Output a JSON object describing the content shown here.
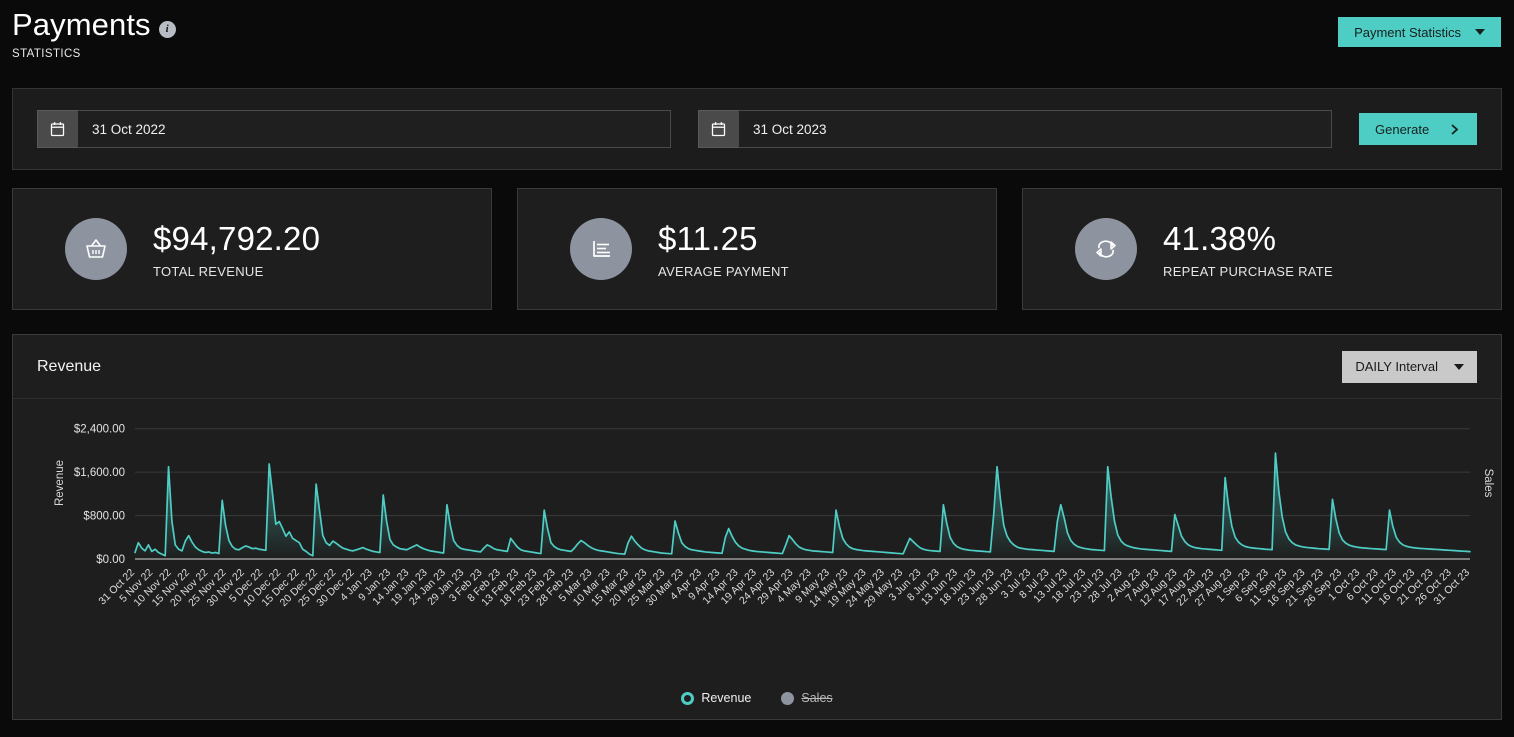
{
  "header": {
    "title": "Payments",
    "subtitle": "STATISTICS",
    "info_icon": "info-icon",
    "primary_button": {
      "label": "Payment Statistics",
      "icon": "chevron-down-icon",
      "color": "#4ecdc4"
    }
  },
  "filters": {
    "start_date": {
      "value": "31 Oct 2022",
      "placeholder": "31 Oct 2022",
      "icon": "calendar-icon"
    },
    "end_date": {
      "value": "31 Oct 2023",
      "placeholder": "31 Oct 2023",
      "icon": "calendar-icon"
    },
    "generate_button": {
      "label": "Generate",
      "icon": "chevron-right-icon",
      "color": "#4ecdc4"
    }
  },
  "stats": [
    {
      "value": "$94,792.20",
      "label": "TOTAL REVENUE",
      "icon": "shopping-basket-icon"
    },
    {
      "value": "$11.25",
      "label": "AVERAGE PAYMENT",
      "icon": "bar-chart-icon"
    },
    {
      "value": "41.38%",
      "label": "REPEAT PURCHASE RATE",
      "icon": "repeat-icon"
    }
  ],
  "chart_panel": {
    "title": "Revenue",
    "interval_button": {
      "label": "DAILY Interval",
      "icon": "chevron-down-icon"
    }
  },
  "chart_data": {
    "type": "line",
    "title": "Revenue",
    "xlabel": "",
    "ylabel": "Revenue",
    "y2label": "Sales",
    "ylim": [
      0,
      2800
    ],
    "yticks": [
      0,
      800,
      1600,
      2400
    ],
    "ytick_labels": [
      "$0.00",
      "$800.00",
      "$1,600.00",
      "$2,400.00"
    ],
    "grid": true,
    "legend_position": "bottom",
    "legend": [
      {
        "name": "Revenue",
        "color": "#4ecdc4",
        "enabled": true
      },
      {
        "name": "Sales",
        "color": "#8e93a0",
        "enabled": false
      }
    ],
    "xtick_labels": [
      "31 Oct 22",
      "5 Nov 22",
      "10 Nov 22",
      "15 Nov 22",
      "20 Nov 22",
      "25 Nov 22",
      "30 Nov 22",
      "5 Dec 22",
      "10 Dec 22",
      "15 Dec 22",
      "20 Dec 22",
      "25 Dec 22",
      "30 Dec 22",
      "4 Jan 23",
      "9 Jan 23",
      "14 Jan 23",
      "19 Jan 23",
      "24 Jan 23",
      "29 Jan 23",
      "3 Feb 23",
      "8 Feb 23",
      "13 Feb 23",
      "18 Feb 23",
      "23 Feb 23",
      "28 Feb 23",
      "5 Mar 23",
      "10 Mar 23",
      "15 Mar 23",
      "20 Mar 23",
      "25 Mar 23",
      "30 Mar 23",
      "4 Apr 23",
      "9 Apr 23",
      "14 Apr 23",
      "19 Apr 23",
      "24 Apr 23",
      "29 Apr 23",
      "4 May 23",
      "9 May 23",
      "14 May 23",
      "19 May 23",
      "24 May 23",
      "29 May 23",
      "3 Jun 23",
      "8 Jun 23",
      "13 Jun 23",
      "18 Jun 23",
      "23 Jun 23",
      "28 Jun 23",
      "3 Jul 23",
      "8 Jul 23",
      "13 Jul 23",
      "18 Jul 23",
      "23 Jul 23",
      "28 Jul 23",
      "2 Aug 23",
      "7 Aug 23",
      "12 Aug 23",
      "17 Aug 23",
      "22 Aug 23",
      "27 Aug 23",
      "1 Sep 23",
      "6 Sep 23",
      "11 Sep 23",
      "16 Sep 23",
      "21 Sep 23",
      "26 Sep 23",
      "1 Oct 23",
      "6 Oct 23",
      "11 Oct 23",
      "16 Oct 23",
      "21 Oct 23",
      "26 Oct 23",
      "31 Oct 23"
    ],
    "series": [
      {
        "name": "Revenue",
        "color": "#4ecdc4",
        "values": [
          120,
          300,
          200,
          150,
          260,
          140,
          180,
          120,
          90,
          60,
          1700,
          700,
          260,
          180,
          150,
          330,
          430,
          310,
          220,
          170,
          140,
          120,
          130,
          110,
          120,
          100,
          1080,
          620,
          340,
          230,
          180,
          170,
          210,
          240,
          220,
          190,
          200,
          180,
          170,
          160,
          1750,
          1200,
          640,
          690,
          560,
          420,
          500,
          380,
          340,
          300,
          180,
          140,
          90,
          60,
          1380,
          900,
          430,
          300,
          250,
          330,
          290,
          240,
          200,
          180,
          160,
          150,
          170,
          190,
          210,
          180,
          160,
          140,
          130,
          120,
          1180,
          700,
          360,
          260,
          220,
          190,
          180,
          170,
          200,
          230,
          260,
          220,
          190,
          170,
          150,
          140,
          130,
          120,
          110,
          1000,
          620,
          340,
          250,
          200,
          180,
          170,
          160,
          150,
          140,
          130,
          200,
          260,
          230,
          190,
          170,
          160,
          150,
          140,
          380,
          300,
          220,
          170,
          150,
          140,
          130,
          120,
          110,
          100,
          900,
          560,
          300,
          230,
          190,
          170,
          160,
          150,
          140,
          200,
          280,
          340,
          300,
          250,
          210,
          180,
          160,
          150,
          140,
          130,
          120,
          110,
          100,
          95,
          90,
          300,
          420,
          330,
          260,
          200,
          170,
          150,
          140,
          130,
          120,
          110,
          105,
          100,
          95,
          700,
          480,
          300,
          230,
          190,
          170,
          160,
          150,
          140,
          130,
          125,
          120,
          115,
          110,
          105,
          400,
          560,
          420,
          310,
          240,
          200,
          180,
          160,
          150,
          140,
          135,
          130,
          125,
          120,
          115,
          110,
          105,
          100,
          260,
          430,
          360,
          280,
          220,
          190,
          170,
          160,
          150,
          145,
          140,
          135,
          130,
          125,
          120,
          900,
          600,
          380,
          280,
          220,
          190,
          175,
          165,
          155,
          150,
          145,
          140,
          135,
          130,
          125,
          120,
          115,
          110,
          105,
          100,
          95,
          240,
          380,
          320,
          260,
          210,
          180,
          165,
          155,
          150,
          145,
          140,
          1000,
          660,
          400,
          290,
          230,
          200,
          180,
          170,
          160,
          155,
          150,
          145,
          140,
          135,
          130,
          820,
          1700,
          1100,
          620,
          420,
          320,
          260,
          220,
          200,
          190,
          180,
          175,
          170,
          165,
          160,
          155,
          150,
          145,
          140,
          700,
          1000,
          760,
          480,
          340,
          270,
          230,
          210,
          195,
          185,
          175,
          170,
          165,
          160,
          155,
          1700,
          1150,
          700,
          440,
          330,
          270,
          240,
          220,
          205,
          195,
          185,
          180,
          175,
          170,
          165,
          160,
          155,
          150,
          145,
          140,
          820,
          620,
          420,
          320,
          260,
          230,
          210,
          200,
          190,
          185,
          180,
          175,
          170,
          165,
          160,
          1500,
          980,
          600,
          400,
          310,
          260,
          230,
          215,
          205,
          198,
          192,
          186,
          180,
          176,
          172,
          1950,
          1250,
          780,
          500,
          370,
          300,
          260,
          240,
          225,
          215,
          208,
          202,
          196,
          190,
          186,
          182,
          178,
          1100,
          740,
          480,
          350,
          290,
          255,
          235,
          222,
          212,
          205,
          200,
          195,
          190,
          186,
          182,
          178,
          174,
          900,
          600,
          400,
          310,
          260,
          235,
          220,
          210,
          202,
          196,
          192,
          188,
          184,
          180,
          176,
          172,
          168,
          164,
          160,
          156,
          152,
          148,
          144,
          140,
          136
        ]
      }
    ]
  }
}
